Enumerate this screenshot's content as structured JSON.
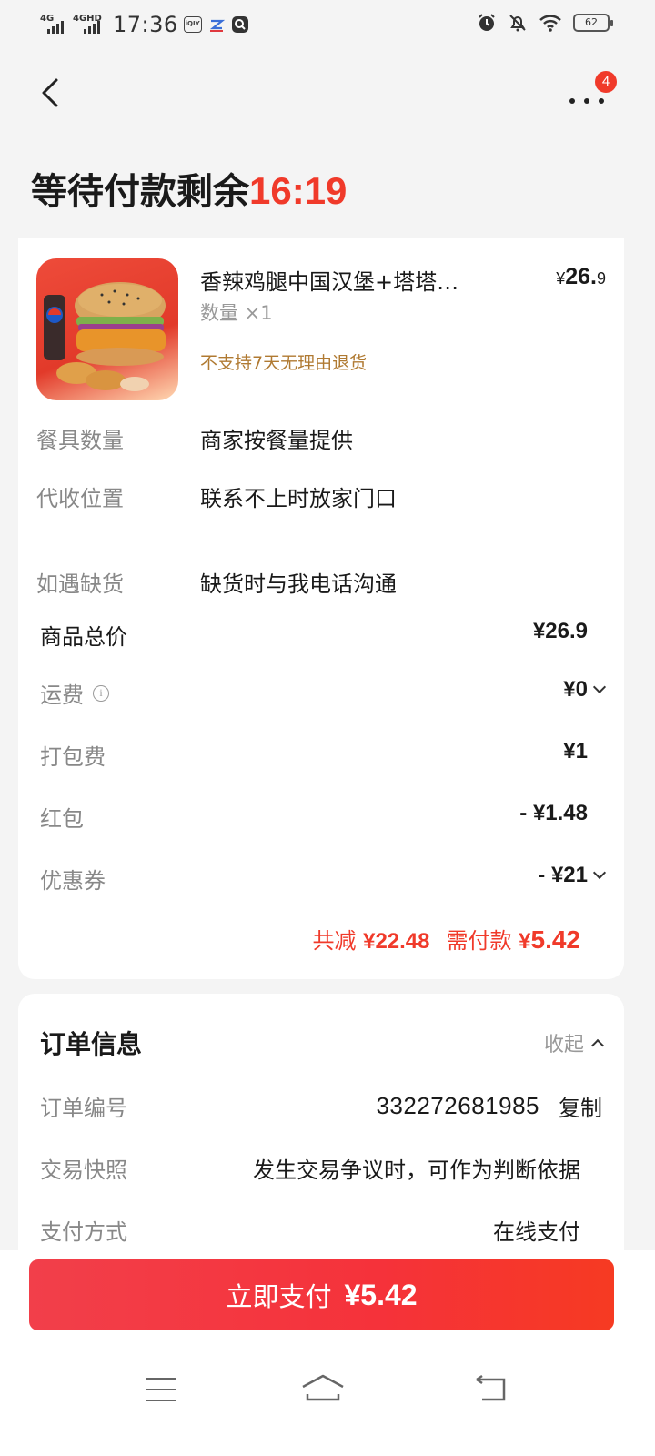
{
  "status_bar": {
    "signal1": "4G",
    "signal2": "4GHD",
    "time": "17:36",
    "app_icon_1": "iQIY",
    "battery": "62"
  },
  "header": {
    "more_badge": "4",
    "countdown_label": "等待付款剩余",
    "countdown_time": "16:19"
  },
  "product": {
    "name": "香辣鸡腿中国汉堡+塔塔…",
    "price_symbol": "¥",
    "price_int": "26.",
    "price_dec": "9",
    "quantity": "数量 ×1",
    "return_note": "不支持7天无理由退货"
  },
  "details": [
    {
      "label": "餐具数量",
      "value": "商家按餐量提供"
    },
    {
      "label": "代收位置",
      "value": "联系不上时放家门口"
    },
    {
      "label": "如遇缺货",
      "value": "缺货时与我电话沟通"
    }
  ],
  "fees": {
    "goods_total": {
      "label": "商品总价",
      "value": "¥26.9"
    },
    "shipping": {
      "label": "运费",
      "value": "¥0"
    },
    "packing": {
      "label": "打包费",
      "value": "¥1"
    },
    "red_packet": {
      "label": "红包",
      "value": "- ¥1.48"
    },
    "coupon": {
      "label": "优惠券",
      "value": "- ¥21"
    }
  },
  "summary": {
    "discount_label": "共减",
    "discount_value": "¥22.48",
    "payable_label": "需付款",
    "payable_symbol": "¥",
    "payable_value": "5.42"
  },
  "order_info": {
    "title": "订单信息",
    "collapse_label": "收起",
    "order_no_label": "订单编号",
    "order_no": "332272681985",
    "copy_label": "复制",
    "snapshot_label": "交易快照",
    "snapshot_value": "发生交易争议时，可作为判断依据",
    "payment_label": "支付方式",
    "payment_value": "在线支付"
  },
  "pay_button": {
    "label": "立即支付",
    "amount": "¥5.42"
  },
  "colors": {
    "accent": "#f03a2a",
    "return_note": "#b07a32",
    "background": "#f4f4f4"
  }
}
